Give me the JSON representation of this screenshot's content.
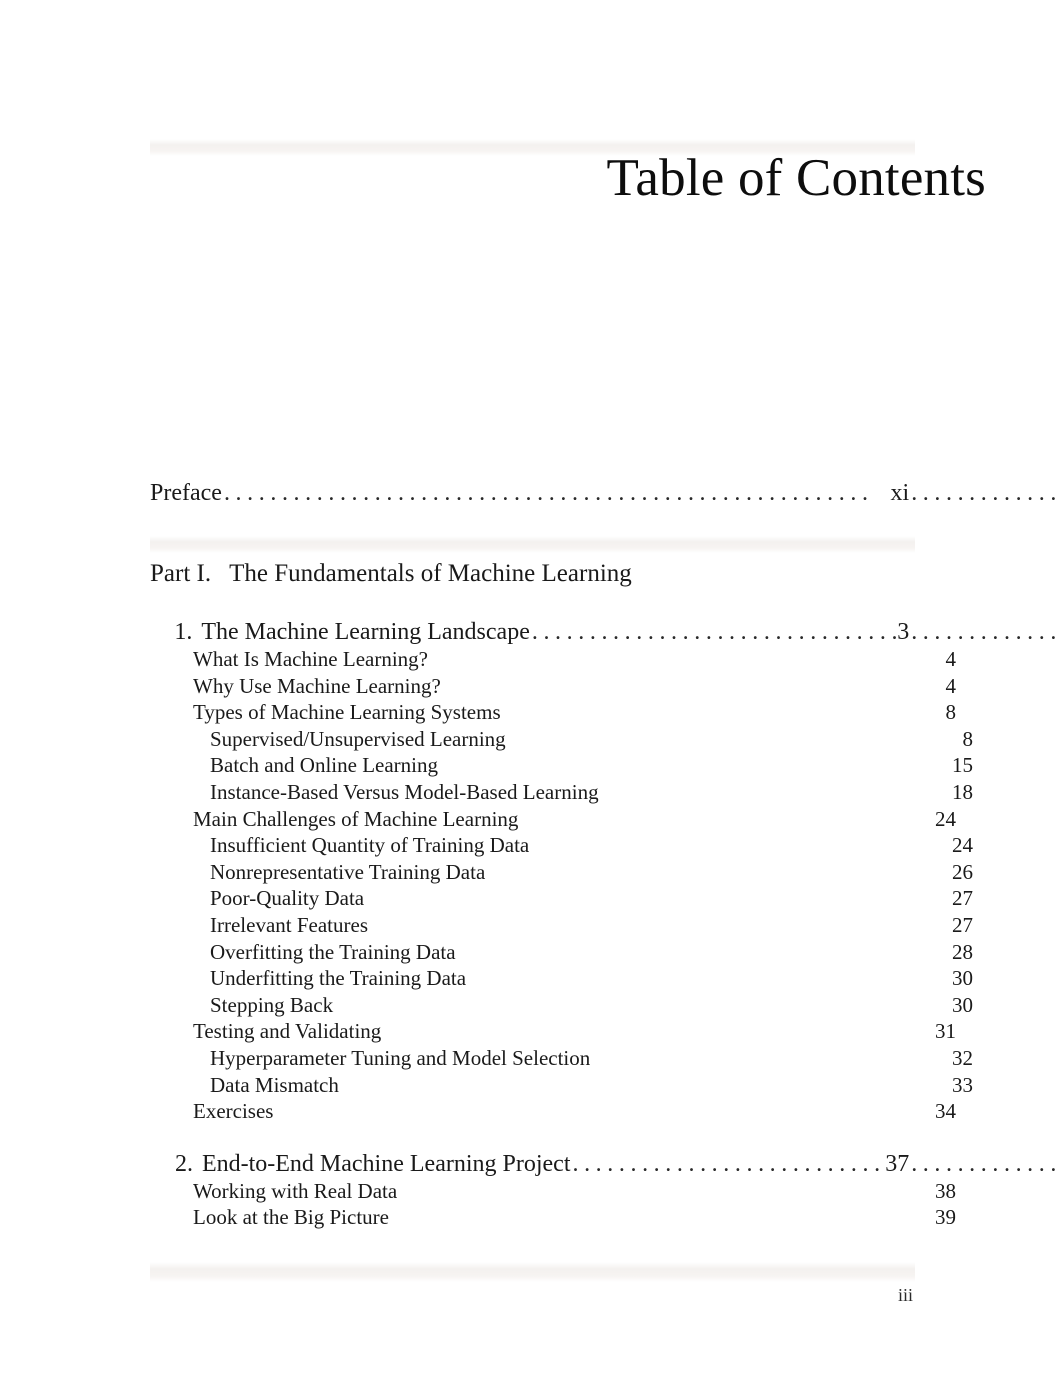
{
  "document": {
    "title": "Table of Contents",
    "folio": "iii"
  },
  "front_matter": {
    "label": "Preface",
    "page": "xi"
  },
  "part": {
    "number": "Part I.",
    "title": "The Fundamentals of Machine Learning"
  },
  "chapters": [
    {
      "number": "1.",
      "title": "The Machine Learning Landscape",
      "page": "3",
      "entries": [
        {
          "level": 1,
          "label": "What Is Machine Learning?",
          "page": "4"
        },
        {
          "level": 1,
          "label": "Why Use Machine Learning?",
          "page": "4"
        },
        {
          "level": 1,
          "label": "Types of Machine Learning Systems",
          "page": "8"
        },
        {
          "level": 2,
          "label": "Supervised/Unsupervised Learning",
          "page": "8"
        },
        {
          "level": 2,
          "label": "Batch and Online Learning",
          "page": "15"
        },
        {
          "level": 2,
          "label": "Instance-Based Versus Model-Based Learning",
          "page": "18"
        },
        {
          "level": 1,
          "label": "Main Challenges of Machine Learning",
          "page": "24"
        },
        {
          "level": 2,
          "label": "Insufficient Quantity of Training Data",
          "page": "24"
        },
        {
          "level": 2,
          "label": "Nonrepresentative Training Data",
          "page": "26"
        },
        {
          "level": 2,
          "label": "Poor-Quality Data",
          "page": "27"
        },
        {
          "level": 2,
          "label": "Irrelevant Features",
          "page": "27"
        },
        {
          "level": 2,
          "label": "Overfitting the Training Data",
          "page": "28"
        },
        {
          "level": 2,
          "label": "Underfitting the Training Data",
          "page": "30"
        },
        {
          "level": 2,
          "label": "Stepping Back",
          "page": "30"
        },
        {
          "level": 1,
          "label": "Testing and Validating",
          "page": "31"
        },
        {
          "level": 2,
          "label": "Hyperparameter Tuning and Model Selection",
          "page": "32"
        },
        {
          "level": 2,
          "label": "Data Mismatch",
          "page": "33"
        },
        {
          "level": 1,
          "label": "Exercises",
          "page": "34"
        }
      ]
    },
    {
      "number": "2.",
      "title": "End-to-End Machine Learning Project",
      "page": "37",
      "entries": [
        {
          "level": 1,
          "label": "Working with Real Data",
          "page": "38"
        },
        {
          "level": 1,
          "label": "Look at the Big Picture",
          "page": "39"
        }
      ]
    }
  ],
  "leaders": {
    "dot_char": "."
  }
}
